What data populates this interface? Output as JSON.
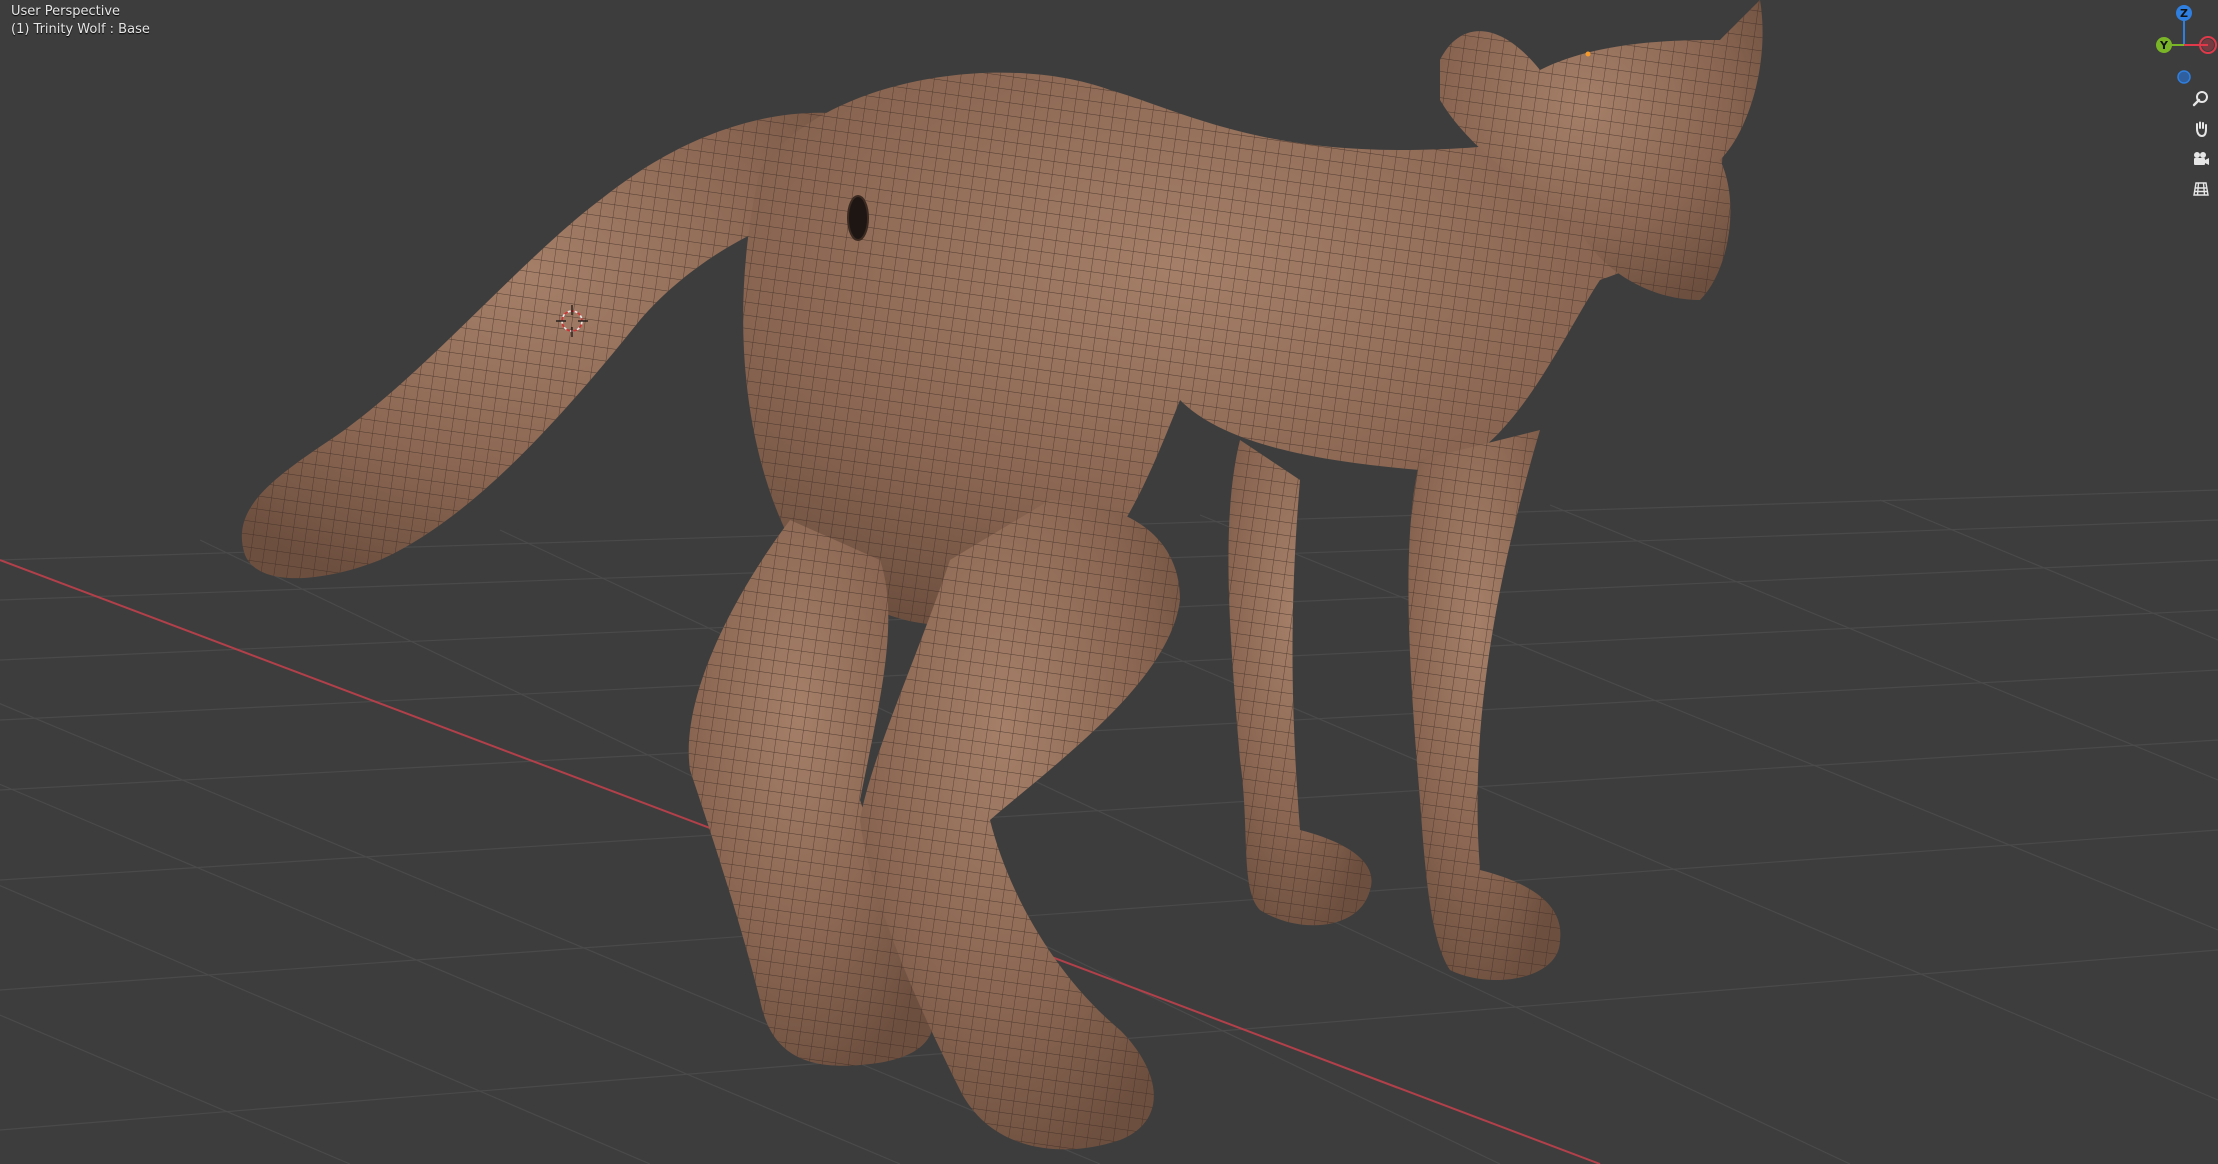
{
  "viewport": {
    "view_name": "User Perspective",
    "object_info": "(1) Trinity Wolf : Base"
  },
  "gizmo": {
    "axis_z": "Z",
    "axis_y": "Y",
    "color_z": "#2f7fe0",
    "color_y": "#7ab527",
    "color_x": "#e0394a"
  },
  "nav_buttons": {
    "zoom_icon": "zoom-magnifier-icon",
    "pan_icon": "hand-pan-icon",
    "camera_icon": "camera-view-icon",
    "ortho_icon": "ortho-grid-icon"
  },
  "colors": {
    "background": "#3d3d3d",
    "grid_line": "#4a4a4a",
    "x_axis": "#b2404a",
    "mesh_fill": "#8e6a56",
    "wire": "#3a2a22"
  }
}
